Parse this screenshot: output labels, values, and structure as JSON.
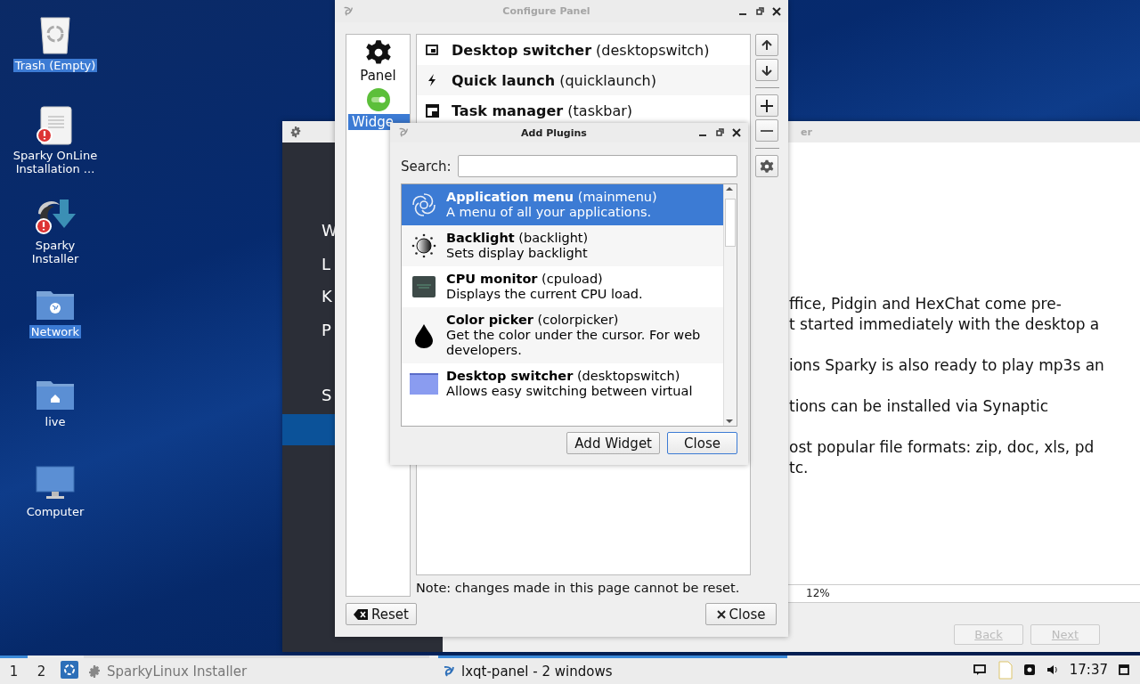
{
  "desktop_icons": [
    {
      "label": "Trash (Empty)",
      "kind": "trash",
      "selected": true
    },
    {
      "label": "Sparky OnLine Installation ...",
      "kind": "document",
      "selected": false
    },
    {
      "label": "Sparky Installer",
      "kind": "installer",
      "selected": false
    },
    {
      "label": "Network",
      "kind": "network",
      "selected": true
    },
    {
      "label": "live",
      "kind": "home",
      "selected": false
    },
    {
      "label": "Computer",
      "kind": "computer",
      "selected": false
    }
  ],
  "installer_window": {
    "title": "er",
    "sidebar": [
      {
        "label": "W",
        "selected": false
      },
      {
        "label": "L",
        "selected": false
      },
      {
        "label": "K",
        "selected": false
      },
      {
        "label": "P",
        "selected": false
      },
      {
        "label": "S",
        "selected": false
      },
      {
        "selected": true
      }
    ],
    "paragraphs": [
      {
        "lines": [
          "ffice, Pidgin and HexChat come pre-",
          "t started immediately with the desktop a"
        ]
      },
      {
        "lines": [
          "ions Sparky is also ready to play mp3s an"
        ]
      },
      {
        "lines": [
          "tions can be installed via Synaptic"
        ]
      },
      {
        "lines": [
          "ost popular file formats: zip, doc, xls, pd",
          "tc."
        ]
      }
    ],
    "progress_text": "12%",
    "buttons": [
      {
        "label": "Back",
        "disabled": true
      },
      {
        "label": "Next",
        "disabled": true
      }
    ]
  },
  "configure_panel": {
    "title": "Configure Panel",
    "sections": [
      {
        "label": "Panel",
        "kind": "gear",
        "selected": false
      },
      {
        "label": "Widge",
        "kind": "widgets",
        "selected": true
      }
    ],
    "widgets": [
      {
        "text": "**Desktop switcher** (desktopswitch)",
        "kind": "desktop",
        "selected": false
      },
      {
        "text": "**Quick launch** (quicklaunch)",
        "kind": "launch",
        "selected": false
      },
      {
        "text": "**Task manager** (taskbar)",
        "kind": "taskbar",
        "selected": false
      }
    ],
    "side_buttons": [
      {
        "kind": "up"
      },
      {
        "kind": "down"
      },
      {
        "kind": "add"
      },
      {
        "kind": "remove"
      },
      {
        "kind": "settings"
      }
    ],
    "note": "Note: changes made in this page cannot be reset.",
    "buttons": [
      {
        "label": "Reset",
        "kind": "reset"
      },
      {
        "label": "Close",
        "kind": "close"
      }
    ]
  },
  "add_plugins": {
    "title": "Add Plugins",
    "search": {
      "label": "Search:"
    },
    "plugins": [
      {
        "text": "**Application menu** (mainmenu)",
        "description": "A menu of all your applications.",
        "kind": "menu",
        "selected": true
      },
      {
        "text": "**Backlight** (backlight)",
        "description": "Sets display backlight",
        "kind": "backlight",
        "selected": false
      },
      {
        "text": "**CPU monitor** (cpuload)",
        "description": "Displays the current CPU load.",
        "kind": "cpu",
        "selected": false
      },
      {
        "text": "**Color picker** (colorpicker)",
        "description": "Get the color under the cursor. For web developers.",
        "kind": "drop",
        "selected": false
      },
      {
        "text": "**Desktop switcher** (desktopswitch)",
        "description": "Allows easy switching between virtual",
        "kind": "desktop",
        "selected": false
      }
    ],
    "buttons": [
      {
        "label": "Add Widget",
        "focused": false
      },
      {
        "label": "Close",
        "focused": true
      }
    ]
  },
  "taskbar": {
    "desktops": [
      {
        "label": "1",
        "selected": true
      },
      {
        "label": "2",
        "selected": false
      }
    ],
    "tasks": [
      {
        "label": "SparkyLinux Installer",
        "kind": "installer",
        "active": false
      },
      {
        "label": "lxqt-panel - 2 windows",
        "kind": "panel",
        "active": true
      }
    ],
    "clock": "17:37"
  }
}
